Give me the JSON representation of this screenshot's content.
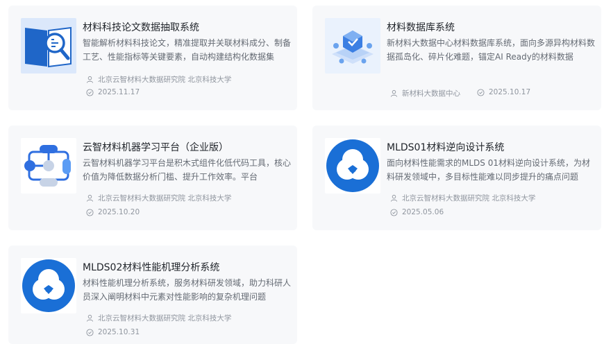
{
  "cards": [
    {
      "title": "材料科技论文数据抽取系统",
      "desc": "智能解析材料科技论文，精准提取并关联材料成分、制备工艺、性能指标等关键要素，自动构建结构化数据集",
      "org": "北京云智材料大数据研究院 北京科技大学",
      "date": "2025.11.17",
      "thumb_icon": "document-search-icon"
    },
    {
      "title": "材料数据库系统",
      "desc": "新材料大数据中心材料数据库系统，面向多源异构材料数据孤岛化、碎片化难题，锚定AI Ready的材料数据",
      "org": "新材料大数据中心",
      "date": "2025.10.17",
      "thumb_icon": "database-cube-icon"
    },
    {
      "title": "云智材料机器学习平台（企业版）",
      "desc": "云智材料机器学习平台是积木式组件化低代码工具，核心价值为降低数据分析门槛、提升工作效率。平台",
      "org": "北京云智材料大数据研究院 北京科技大学",
      "date": "2025.10.20",
      "thumb_icon": "workflow-icon"
    },
    {
      "title": "MLDS01材料逆向设计系统",
      "desc": "面向材料性能需求的MLDS 01材料逆向设计系统，为材料研发领域中，多目标性能难以同步提升的痛点问题",
      "org": "北京云智材料大数据研究院 北京科技大学",
      "date": "2025.05.06",
      "thumb_icon": "mlds-logo-icon"
    },
    {
      "title": "MLDS02材料性能机理分析系统",
      "desc": "材料性能机理分析系统，服务材料研发领域，助力科研人员深入阐明材料中元素对性能影响的复杂机理问题",
      "org": "北京云智材料大数据研究院 北京科技大学",
      "date": "2025.10.31",
      "thumb_icon": "mlds-logo-icon"
    }
  ],
  "colors": {
    "card_bg": "#f7f8fa",
    "title": "#1f2329",
    "desc": "#646a73",
    "meta": "#8f959e",
    "brand_blue": "#1a6fd6"
  }
}
